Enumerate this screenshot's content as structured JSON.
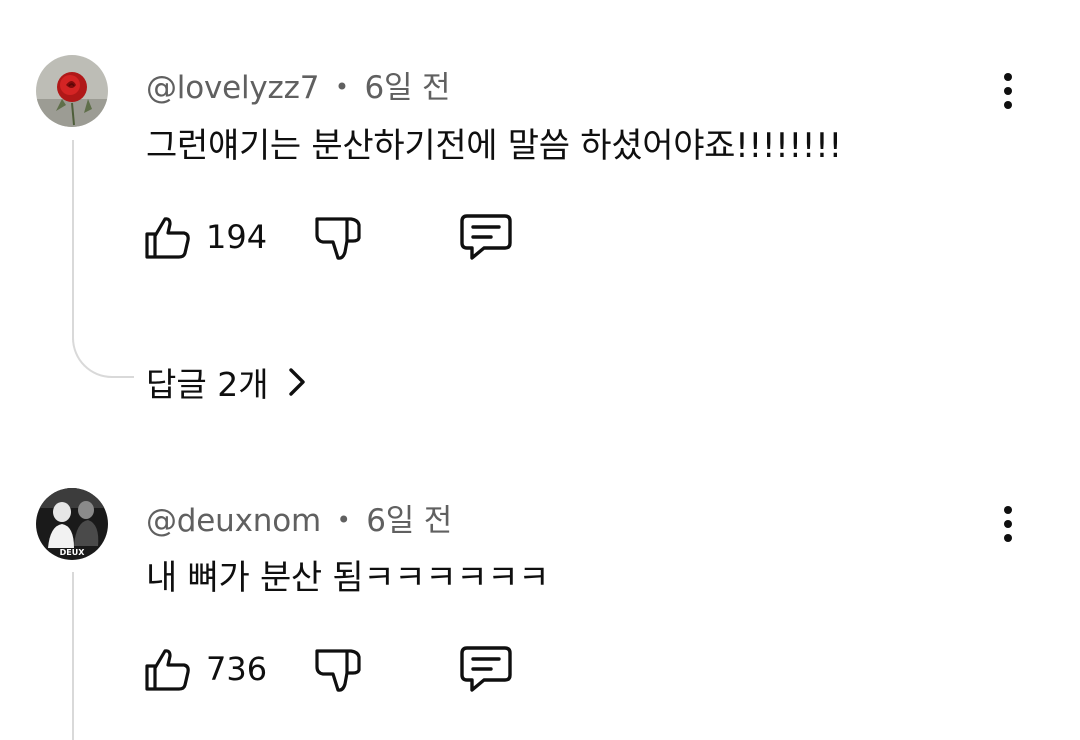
{
  "comments": [
    {
      "author": "@lovelyzz7",
      "separator": "•",
      "time": "6일 전",
      "text": "그런얘기는 분산하기전에 말씀 하셨어야죠!!!!!!!!",
      "likes": "194",
      "replies_label": "답글 2개",
      "avatar_icon": "rose-avatar"
    },
    {
      "author": "@deuxnom",
      "separator": "•",
      "time": "6일 전",
      "text": "내 뼈가 분산 됨ㅋㅋㅋㅋㅋㅋ",
      "likes": "736",
      "avatar_icon": "deux-avatar",
      "avatar_label": "DEUX"
    }
  ],
  "icons": {
    "like": "thumbs-up-icon",
    "dislike": "thumbs-down-icon",
    "reply": "comment-icon",
    "more": "more-vertical-icon",
    "chevron": "chevron-right-icon"
  }
}
